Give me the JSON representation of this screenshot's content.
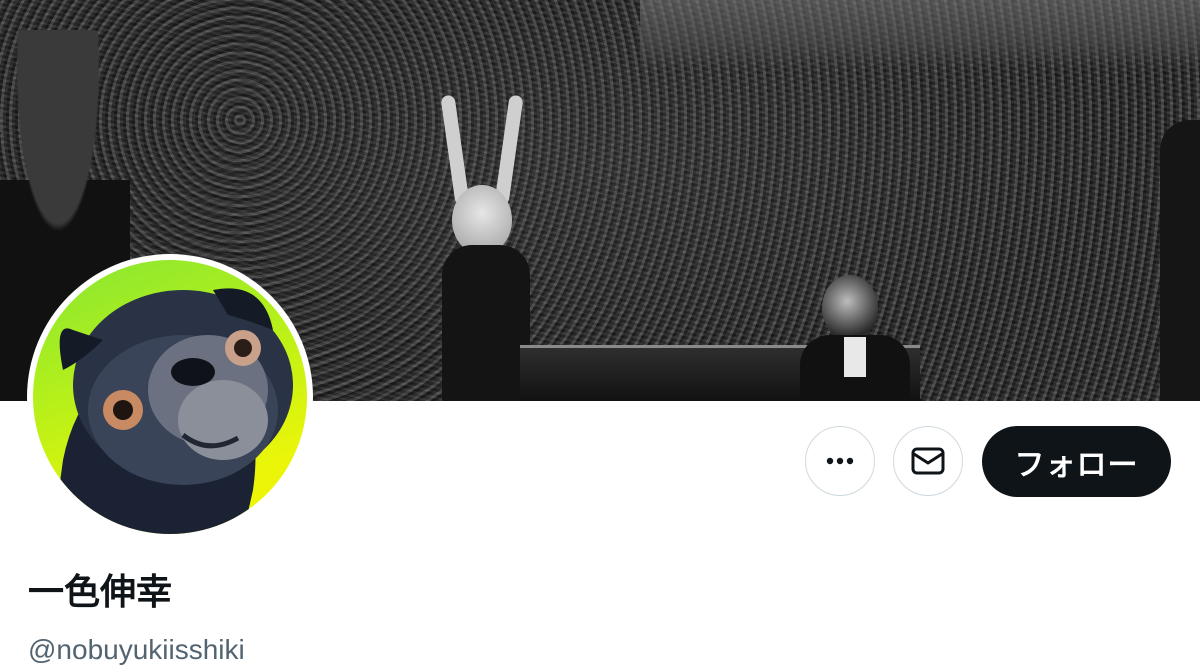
{
  "profile": {
    "display_name": "一色伸幸",
    "handle": "@nobuyukiisshiki"
  },
  "actions": {
    "more_icon": "more-horizontal-icon",
    "message_icon": "envelope-icon",
    "follow_label": "フォロー"
  },
  "colors": {
    "follow_button_bg": "#0f1419",
    "follow_button_text": "#ffffff",
    "handle_text": "#536471",
    "button_border": "#cfd9de",
    "avatar_background": "#b6f01a"
  }
}
